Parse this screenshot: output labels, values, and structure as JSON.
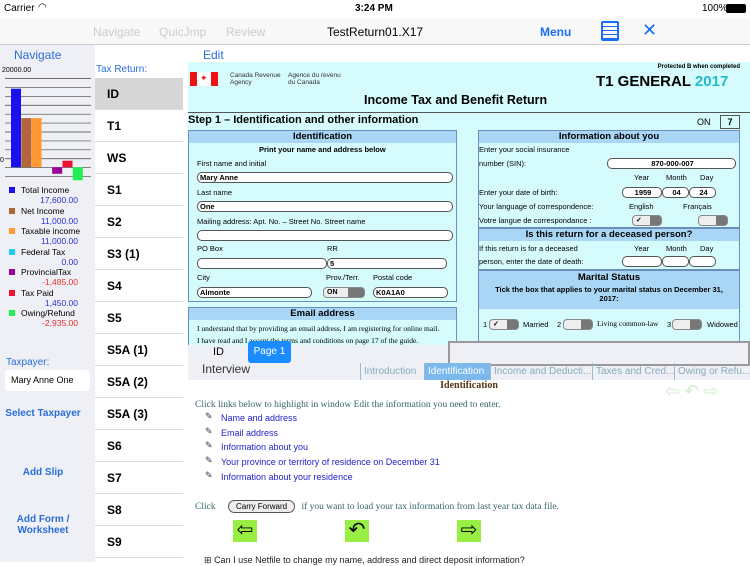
{
  "status": {
    "carrier": "Carrier",
    "time": "3:24 PM",
    "battery": "100%"
  },
  "nav": {
    "navigate": "Navigate",
    "quicjmp": "QuicJmp",
    "review": "Review",
    "title": "TestReturn01.X17",
    "menu": "Menu"
  },
  "left": {
    "title": "Navigate",
    "chart_max": "20000.00",
    "chart_zero": "0",
    "legend": [
      {
        "label": "Total Income",
        "value": "17,600.00",
        "color": "#1a10f0"
      },
      {
        "label": "Net Income",
        "value": "11,000.00",
        "color": "#b0663a"
      },
      {
        "label": "Taxable income",
        "value": "11,000.00",
        "color": "#ff9933"
      },
      {
        "label": "Federal Tax",
        "value": "0.00",
        "color": "#22ccee"
      },
      {
        "label": "ProvincialTax",
        "value": "-1,485.00",
        "color": "#990099"
      },
      {
        "label": "Tax Paid",
        "value": "1,450.00",
        "color": "#ee1133"
      },
      {
        "label": "Owing/Refund",
        "value": "-2,935.00",
        "color": "#22ee55"
      }
    ],
    "taxpayer_label": "Taxpayer:",
    "taxpayer": "Mary Anne One",
    "select_taxpayer": "Select Taxpayer",
    "add_slip": "Add Slip",
    "add_form": "Add Form / Worksheet"
  },
  "chart_data": {
    "type": "bar",
    "categories": [
      "Total Income",
      "Net Income",
      "Taxable income",
      "Federal Tax",
      "ProvincialTax",
      "Tax Paid",
      "Owing/Refund"
    ],
    "values": [
      17600,
      11000,
      11000,
      0,
      -1485,
      1450,
      -2935
    ],
    "ylim": [
      -4000,
      20000
    ]
  },
  "taxreturn": {
    "label": "Tax Return:",
    "items": [
      "ID",
      "T1",
      "WS",
      "S1",
      "S2",
      "S3 (1)",
      "S4",
      "S5",
      "S5A (1)",
      "S5A (2)",
      "S5A (3)",
      "S6",
      "S7",
      "S8",
      "S9"
    ]
  },
  "edit": {
    "label": "Edit",
    "protected": "Protected B when completed",
    "cra_en": "Canada Revenue Agency",
    "cra_fr": "Agence du revenu du Canada",
    "t1": "T1 GENERAL",
    "year": "2017",
    "title": "Income Tax and Benefit Return",
    "step": "Step 1 – Identification and other information",
    "prov": "ON",
    "prov_code": "7",
    "ident": {
      "head": "Identification",
      "sub": "Print your name and address below",
      "first_label": "First name and initial",
      "first": "Mary Anne",
      "last_label": "Last name",
      "last": "One",
      "mail_label": "Mailing address: Apt. No. – Street No. Street name",
      "mail": "",
      "po_label": "PO Box",
      "po": "",
      "rr_label": "RR",
      "rr": "5",
      "city_label": "City",
      "city": "Almonte",
      "provterr_label": "Prov./Terr.",
      "provterr": "ON",
      "postal_label": "Postal code",
      "postal": "K0A1A0"
    },
    "email": {
      "head": "Email address",
      "l1": "I understand that by providing an email address, I am registering for online mail.",
      "l2": "I have read and I accept the terms and conditions on page 17 of the guide."
    },
    "about": {
      "head": "Information about you",
      "sin_l1": "Enter your social insurance",
      "sin_l2": "number (SIN):",
      "sin": "870-000-007",
      "year": "Year",
      "month": "Month",
      "day": "Day",
      "dob_label": "Enter your date of birth:",
      "dob_y": "1959",
      "dob_m": "04",
      "dob_d": "24",
      "lang_en": "Your language of correspondence:",
      "lang_fr": "Votre langue de correspondance :",
      "english": "English",
      "francais": "Français",
      "english_sel": "✓"
    },
    "deceased": {
      "head": "Is this return for a deceased person?",
      "l1": "If this return is for a deceased",
      "l2": "person, enter the date of death:"
    },
    "marital": {
      "head": "Marital Status",
      "sub": "Tick the box that applies to your marital status on December 31, 2017:",
      "o1": "Married",
      "o2": "Living common-law",
      "o3": "Widowed",
      "sel1": "✓"
    }
  },
  "interview": {
    "tab_id": "ID",
    "tab_page": "Page 1",
    "label": "Interview",
    "tabs": [
      "Introduction",
      "Identification",
      "Income and Deducti...",
      "Taxes and Cred...",
      "Owing or Refu..."
    ],
    "heading": "Identification",
    "intro": "Click links below to highlight in window Edit the information you need to enter.",
    "links": [
      "Name and address",
      "Email address",
      "Information about you",
      "Your province or territory of residence on December 31",
      "Information about your residence"
    ],
    "click": "Click",
    "carry": "Carry Forward",
    "carry_after": "if you want to load your tax information from last year tax data file.",
    "faq": "Can I use Netfile to change my name, address and direct deposit information?"
  }
}
